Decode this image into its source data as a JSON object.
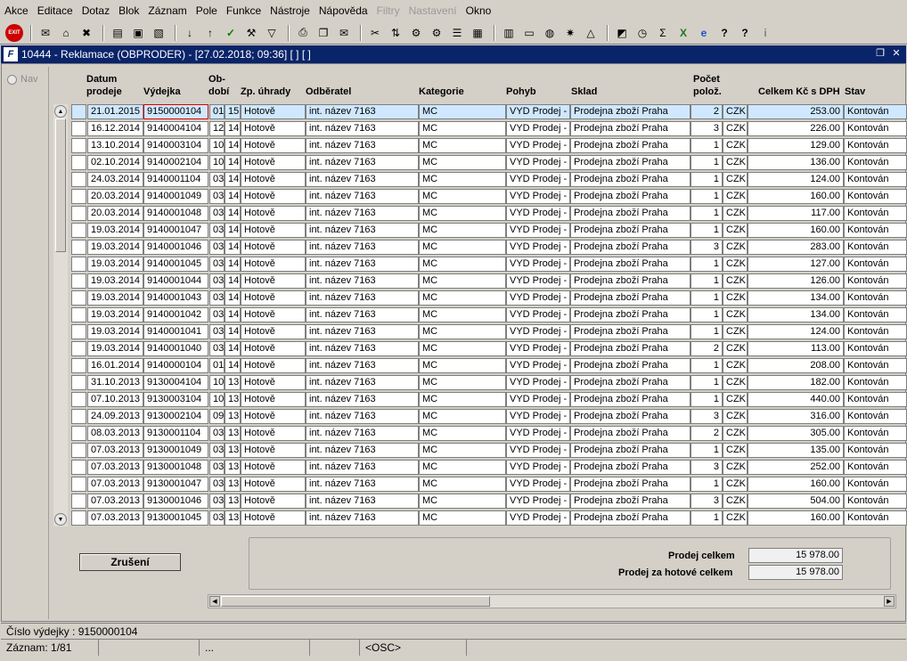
{
  "menu": [
    "Akce",
    "Editace",
    "Dotaz",
    "Blok",
    "Záznam",
    "Pole",
    "Funkce",
    "Nástroje",
    "Nápověda",
    "Filtry",
    "Nastavení",
    "Okno"
  ],
  "menu_disabled": [
    "Filtry",
    "Nastavení"
  ],
  "toolbar": {
    "exit_label": "EXIT"
  },
  "window": {
    "logo": "F",
    "title": "10444 - Reklamace (OBPRODER) - [27.02.2018; 09:36]  [ ]  [ ]"
  },
  "nav": {
    "label": "Nav"
  },
  "columns": {
    "datum": "Datum\nprodeje",
    "vydejka": "Výdejka",
    "obdobi": "Ob-\ndobí",
    "zp_uhrady": "Zp. úhrady",
    "odberatel": "Odběratel",
    "kategorie": "Kategorie",
    "pohyb": "Pohyb",
    "sklad": "Sklad",
    "pocet": "Počet\npolož.",
    "celkem": "Celkem Kč s DPH",
    "stav": "Stav"
  },
  "rows": [
    [
      "21.01.2015",
      "9150000104",
      "01",
      "15",
      "Hotově",
      "int. název 7163",
      "MC",
      "VYD Prodej -",
      "Prodejna zboží Praha",
      "2",
      "CZK",
      "253.00",
      "Kontován"
    ],
    [
      "16.12.2014",
      "9140004104",
      "12",
      "14",
      "Hotově",
      "int. název 7163",
      "MC",
      "VYD Prodej -",
      "Prodejna zboží Praha",
      "3",
      "CZK",
      "226.00",
      "Kontován"
    ],
    [
      "13.10.2014",
      "9140003104",
      "10",
      "14",
      "Hotově",
      "int. název 7163",
      "MC",
      "VYD Prodej -",
      "Prodejna zboží Praha",
      "1",
      "CZK",
      "129.00",
      "Kontován"
    ],
    [
      "02.10.2014",
      "9140002104",
      "10",
      "14",
      "Hotově",
      "int. název 7163",
      "MC",
      "VYD Prodej -",
      "Prodejna zboží Praha",
      "1",
      "CZK",
      "136.00",
      "Kontován"
    ],
    [
      "24.03.2014",
      "9140001104",
      "03",
      "14",
      "Hotově",
      "int. název 7163",
      "MC",
      "VYD Prodej -",
      "Prodejna zboží Praha",
      "1",
      "CZK",
      "124.00",
      "Kontován"
    ],
    [
      "20.03.2014",
      "9140001049",
      "03",
      "14",
      "Hotově",
      "int. název 7163",
      "MC",
      "VYD Prodej -",
      "Prodejna zboží Praha",
      "1",
      "CZK",
      "160.00",
      "Kontován"
    ],
    [
      "20.03.2014",
      "9140001048",
      "03",
      "14",
      "Hotově",
      "int. název 7163",
      "MC",
      "VYD Prodej -",
      "Prodejna zboží Praha",
      "1",
      "CZK",
      "117.00",
      "Kontován"
    ],
    [
      "19.03.2014",
      "9140001047",
      "03",
      "14",
      "Hotově",
      "int. název 7163",
      "MC",
      "VYD Prodej -",
      "Prodejna zboží Praha",
      "1",
      "CZK",
      "160.00",
      "Kontován"
    ],
    [
      "19.03.2014",
      "9140001046",
      "03",
      "14",
      "Hotově",
      "int. název 7163",
      "MC",
      "VYD Prodej -",
      "Prodejna zboží Praha",
      "3",
      "CZK",
      "283.00",
      "Kontován"
    ],
    [
      "19.03.2014",
      "9140001045",
      "03",
      "14",
      "Hotově",
      "int. název 7163",
      "MC",
      "VYD Prodej -",
      "Prodejna zboží Praha",
      "1",
      "CZK",
      "127.00",
      "Kontován"
    ],
    [
      "19.03.2014",
      "9140001044",
      "03",
      "14",
      "Hotově",
      "int. název 7163",
      "MC",
      "VYD Prodej -",
      "Prodejna zboží Praha",
      "1",
      "CZK",
      "126.00",
      "Kontován"
    ],
    [
      "19.03.2014",
      "9140001043",
      "03",
      "14",
      "Hotově",
      "int. název 7163",
      "MC",
      "VYD Prodej -",
      "Prodejna zboží Praha",
      "1",
      "CZK",
      "134.00",
      "Kontován"
    ],
    [
      "19.03.2014",
      "9140001042",
      "03",
      "14",
      "Hotově",
      "int. název 7163",
      "MC",
      "VYD Prodej -",
      "Prodejna zboží Praha",
      "1",
      "CZK",
      "134.00",
      "Kontován"
    ],
    [
      "19.03.2014",
      "9140001041",
      "03",
      "14",
      "Hotově",
      "int. název 7163",
      "MC",
      "VYD Prodej -",
      "Prodejna zboží Praha",
      "1",
      "CZK",
      "124.00",
      "Kontován"
    ],
    [
      "19.03.2014",
      "9140001040",
      "03",
      "14",
      "Hotově",
      "int. název 7163",
      "MC",
      "VYD Prodej -",
      "Prodejna zboží Praha",
      "2",
      "CZK",
      "113.00",
      "Kontován"
    ],
    [
      "16.01.2014",
      "9140000104",
      "01",
      "14",
      "Hotově",
      "int. název 7163",
      "MC",
      "VYD Prodej -",
      "Prodejna zboží Praha",
      "1",
      "CZK",
      "208.00",
      "Kontován"
    ],
    [
      "31.10.2013",
      "9130004104",
      "10",
      "13",
      "Hotově",
      "int. název 7163",
      "MC",
      "VYD Prodej -",
      "Prodejna zboží Praha",
      "1",
      "CZK",
      "182.00",
      "Kontován"
    ],
    [
      "07.10.2013",
      "9130003104",
      "10",
      "13",
      "Hotově",
      "int. název 7163",
      "MC",
      "VYD Prodej -",
      "Prodejna zboží Praha",
      "1",
      "CZK",
      "440.00",
      "Kontován"
    ],
    [
      "24.09.2013",
      "9130002104",
      "09",
      "13",
      "Hotově",
      "int. název 7163",
      "MC",
      "VYD Prodej -",
      "Prodejna zboží Praha",
      "3",
      "CZK",
      "316.00",
      "Kontován"
    ],
    [
      "08.03.2013",
      "9130001104",
      "03",
      "13",
      "Hotově",
      "int. název 7163",
      "MC",
      "VYD Prodej -",
      "Prodejna zboží Praha",
      "2",
      "CZK",
      "305.00",
      "Kontován"
    ],
    [
      "07.03.2013",
      "9130001049",
      "03",
      "13",
      "Hotově",
      "int. název 7163",
      "MC",
      "VYD Prodej -",
      "Prodejna zboží Praha",
      "1",
      "CZK",
      "135.00",
      "Kontován"
    ],
    [
      "07.03.2013",
      "9130001048",
      "03",
      "13",
      "Hotově",
      "int. název 7163",
      "MC",
      "VYD Prodej -",
      "Prodejna zboží Praha",
      "3",
      "CZK",
      "252.00",
      "Kontován"
    ],
    [
      "07.03.2013",
      "9130001047",
      "03",
      "13",
      "Hotově",
      "int. název 7163",
      "MC",
      "VYD Prodej -",
      "Prodejna zboží Praha",
      "1",
      "CZK",
      "160.00",
      "Kontován"
    ],
    [
      "07.03.2013",
      "9130001046",
      "03",
      "13",
      "Hotově",
      "int. název 7163",
      "MC",
      "VYD Prodej -",
      "Prodejna zboží Praha",
      "3",
      "CZK",
      "504.00",
      "Kontován"
    ],
    [
      "07.03.2013",
      "9130001045",
      "03",
      "13",
      "Hotově",
      "int. název 7163",
      "MC",
      "VYD Prodej -",
      "Prodejna zboží Praha",
      "1",
      "CZK",
      "160.00",
      "Kontován"
    ]
  ],
  "summary": {
    "prodej_label": "Prodej celkem",
    "prodej_value": "15 978.00",
    "hotove_label": "Prodej za hotové celkem",
    "hotove_value": "15 978.00"
  },
  "buttons": {
    "cancel": "Zrušení"
  },
  "status": {
    "line1": "Číslo výdejky : 9150000104",
    "record": "Záznam: 1/81",
    "seg2": "",
    "seg3": "...",
    "seg4": "",
    "seg5": "<OSC>"
  },
  "colors": {
    "title_bar": "#0a246a",
    "current_row": "#cfe8ff",
    "focus_border": "#e00000",
    "exit_red": "#cc0000"
  }
}
